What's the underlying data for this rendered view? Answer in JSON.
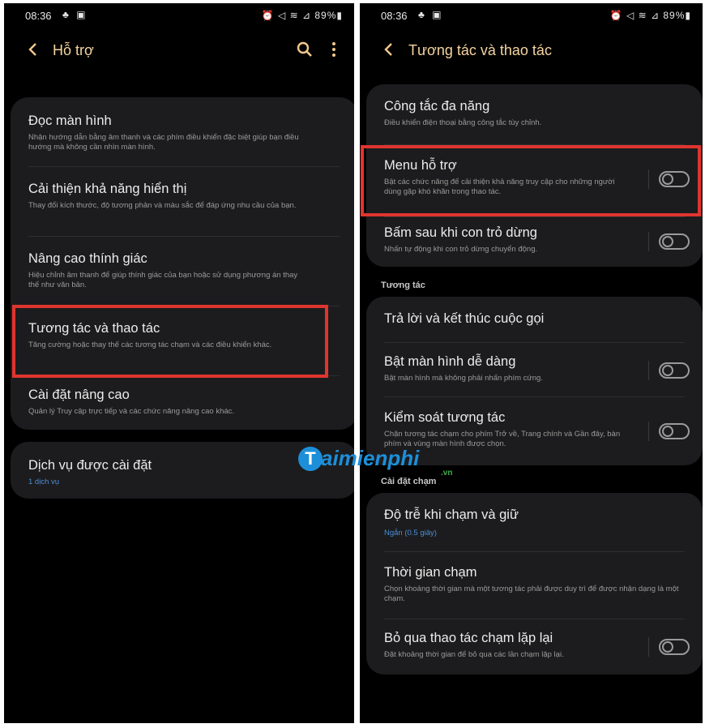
{
  "status_left": {
    "time": "08:36",
    "icons": "♣ ▣",
    "right": "⏰ ◁ ≋ ⊿ 89%▮"
  },
  "status_right": {
    "time": "08:36",
    "icons": "♣ ▣",
    "right": "⏰ ◁ ≋ ⊿ 89%▮"
  },
  "left": {
    "title": "Hỗ trợ",
    "items": [
      {
        "title": "Đọc màn hình",
        "subtitle": "Nhận hướng dẫn bằng âm thanh và các phím điều khiển đặc biệt giúp bạn điều hướng mà không cần nhìn màn hình."
      },
      {
        "title": "Cải thiện khả năng hiển thị",
        "subtitle": "Thay đổi kích thước, độ tương phản và màu sắc để đáp ứng nhu cầu của bạn."
      },
      {
        "title": "Nâng cao thính giác",
        "subtitle": "Hiệu chỉnh âm thanh để giúp thính giác của bạn hoặc sử dụng phương án thay thế như văn bản."
      },
      {
        "title": "Tương tác và thao tác",
        "subtitle": "Tăng cường hoặc thay thế các tương tác chạm và các điều khiển khác."
      },
      {
        "title": "Cài đặt nâng cao",
        "subtitle": "Quản lý Truy cập trực tiếp và các chức năng nâng cao khác."
      }
    ],
    "installed": {
      "title": "Dịch vụ được cài đặt",
      "subtitle": "1 dịch vụ"
    }
  },
  "right": {
    "title": "Tương tác và thao tác",
    "group1": [
      {
        "title": "Công tắc đa năng",
        "subtitle": "Điều khiển điện thoại bằng công tắc tùy chỉnh."
      },
      {
        "title": "Menu hỗ trợ",
        "subtitle": "Bật các chức năng để cải thiện khả năng truy cập cho những người dùng gặp khó khăn trong thao tác."
      },
      {
        "title": "Bấm sau khi con trỏ dừng",
        "subtitle": "Nhấn tự động khi con trỏ dừng chuyển động."
      }
    ],
    "section_interaction": "Tương tác",
    "group2": [
      {
        "title": "Trả lời và kết thúc cuộc gọi"
      },
      {
        "title": "Bật màn hình dễ dàng",
        "subtitle": "Bật màn hình mà không phải nhấn phím cứng."
      },
      {
        "title": "Kiểm soát tương tác",
        "subtitle": "Chặn tương tác chạm cho phím Trở về, Trang chính và Gần đây, bàn phím và vùng màn hình được chọn."
      }
    ],
    "section_touch": "Cài đặt chạm",
    "group3": [
      {
        "title": "Độ trễ khi chạm và giữ",
        "subtitle": "Ngắn (0.5 giây)"
      },
      {
        "title": "Thời gian chạm",
        "subtitle": "Chọn khoảng thời gian mà một tương tác phải được duy trì để được nhận dạng là một chạm."
      },
      {
        "title": "Bỏ qua thao tác chạm lặp lại",
        "subtitle": "Đặt khoảng thời gian để bỏ qua các lần chạm lặp lại."
      }
    ]
  },
  "watermark": {
    "text": "aimienphi",
    "letter": "T",
    "suffix": ".vn"
  },
  "colors": {
    "accent": "#f5d4a0",
    "highlight": "#e0352f",
    "card": "#1c1c1e",
    "subtitle_blue": "#4a8fd6"
  }
}
